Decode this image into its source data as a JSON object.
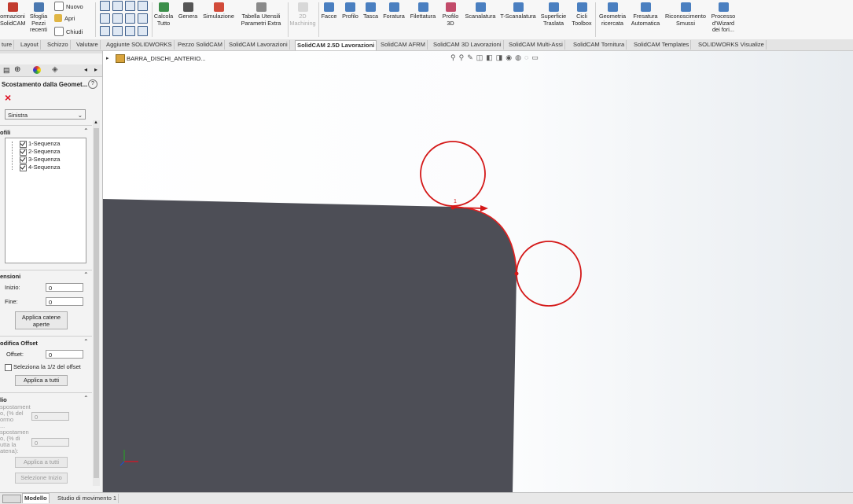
{
  "ribbon": {
    "left_group": [
      {
        "label": "ormazioni SolidCAM",
        "icon": "solidcam-icon"
      },
      {
        "label": "Sfoglia Pezzi recenti",
        "icon": "browse-icon"
      }
    ],
    "file_menu": [
      {
        "label": "Nuovo",
        "icon": "new-file-icon"
      },
      {
        "label": "Apri",
        "icon": "open-folder-icon"
      },
      {
        "label": "Chiudi",
        "icon": "close-file-icon"
      }
    ],
    "commands": [
      {
        "label": "Calcola Tutto",
        "icon": "calculator-icon",
        "enabled": true
      },
      {
        "label": "Genera",
        "icon": "gcode-icon",
        "enabled": true
      },
      {
        "label": "Simulazione",
        "icon": "simulation-icon",
        "enabled": true
      },
      {
        "label": "Tabella Utensili Parametri Extra",
        "icon": "tool-table-icon",
        "enabled": true
      },
      {
        "label": "2D Machining",
        "icon": "machining-2d-icon",
        "enabled": false
      },
      {
        "label": "Facce",
        "icon": "face-icon",
        "enabled": true
      },
      {
        "label": "Profilo",
        "icon": "profile-icon",
        "enabled": true
      },
      {
        "label": "Tasca",
        "icon": "pocket-icon",
        "enabled": true
      },
      {
        "label": "Foratura",
        "icon": "drill-icon",
        "enabled": true
      },
      {
        "label": "Filettatura",
        "icon": "thread-icon",
        "enabled": true
      },
      {
        "label": "Profilo 3D",
        "icon": "profile-3d-icon",
        "enabled": true
      },
      {
        "label": "Scanalatura",
        "icon": "slot-icon",
        "enabled": true
      },
      {
        "label": "T-Scanalatura",
        "icon": "t-slot-icon",
        "enabled": true
      },
      {
        "label": "Superficie Traslata",
        "icon": "translated-surface-icon",
        "enabled": true
      },
      {
        "label": "Cicli Toolbox",
        "icon": "toolbox-icon",
        "enabled": true
      },
      {
        "label": "Geometria ricercata",
        "icon": "geometry-search-icon",
        "enabled": true
      },
      {
        "label": "Fresatura Automatica",
        "icon": "auto-milling-icon",
        "enabled": true
      },
      {
        "label": "Riconoscimento Smussi",
        "icon": "chamfer-recognition-icon",
        "enabled": true
      },
      {
        "label": "Processo d'Wizard dei fori...",
        "icon": "hole-wizard-icon",
        "enabled": true
      }
    ]
  },
  "tabs": [
    {
      "label": "ture",
      "active": false
    },
    {
      "label": "Layout",
      "active": false
    },
    {
      "label": "Schizzo",
      "active": false
    },
    {
      "label": "Valutare",
      "active": false
    },
    {
      "label": "Aggiunte SOLIDWORKS",
      "active": false
    },
    {
      "label": "Pezzo SolidCAM",
      "active": false
    },
    {
      "label": "SolidCAM Lavorazioni",
      "active": false
    },
    {
      "label": "SolidCAM 2.5D Lavorazioni",
      "active": true
    },
    {
      "label": "SolidCAM AFRM",
      "active": false
    },
    {
      "label": "SolidCAM 3D Lavorazioni",
      "active": false
    },
    {
      "label": "SolidCAM Multi-Assi",
      "active": false
    },
    {
      "label": "SolidCAM Tornitura",
      "active": false
    },
    {
      "label": "SolidCAM Templates",
      "active": false
    },
    {
      "label": "SOLIDWORKS Visualize",
      "active": false
    }
  ],
  "panel": {
    "title": "Scostamento dalla Geomet...",
    "help": "?",
    "close": "×",
    "side_value": "Sinistra",
    "profiles": {
      "header": "ofili",
      "items": [
        "1-Sequenza",
        "2-Sequenza",
        "3-Sequenza",
        "4-Sequenza"
      ]
    },
    "extensions": {
      "header": "ensioni",
      "start_label": "Inizio:",
      "start_value": "0",
      "end_label": "Fine:",
      "end_value": "0",
      "apply_button": "Applica catene aperte"
    },
    "offset": {
      "header": "odifica Offset",
      "offset_label": "Offset:",
      "offset_value": "0",
      "half_checkbox": "Seleziona la 1/2 del offset",
      "apply_button": "Applica a tutti"
    },
    "other": {
      "header": "lio",
      "line1": "spostament",
      "line2": "o, (% del",
      "line3": "ormo",
      "line4": "...",
      "value1": "0",
      "line5": "spostamen",
      "line6": "o, (% di",
      "line7": "utta la",
      "line8": "atena):",
      "value2": "0",
      "apply_button": "Applica a tutti",
      "select_button": "Selezione Inizio"
    }
  },
  "viewport": {
    "tree_item": "BARRA_DISCHI_ANTERIO...",
    "point_label": "1"
  },
  "status": {
    "tabs": [
      {
        "label": "Modello",
        "active": true
      },
      {
        "label": "Studio di movimento 1",
        "active": false
      }
    ]
  }
}
